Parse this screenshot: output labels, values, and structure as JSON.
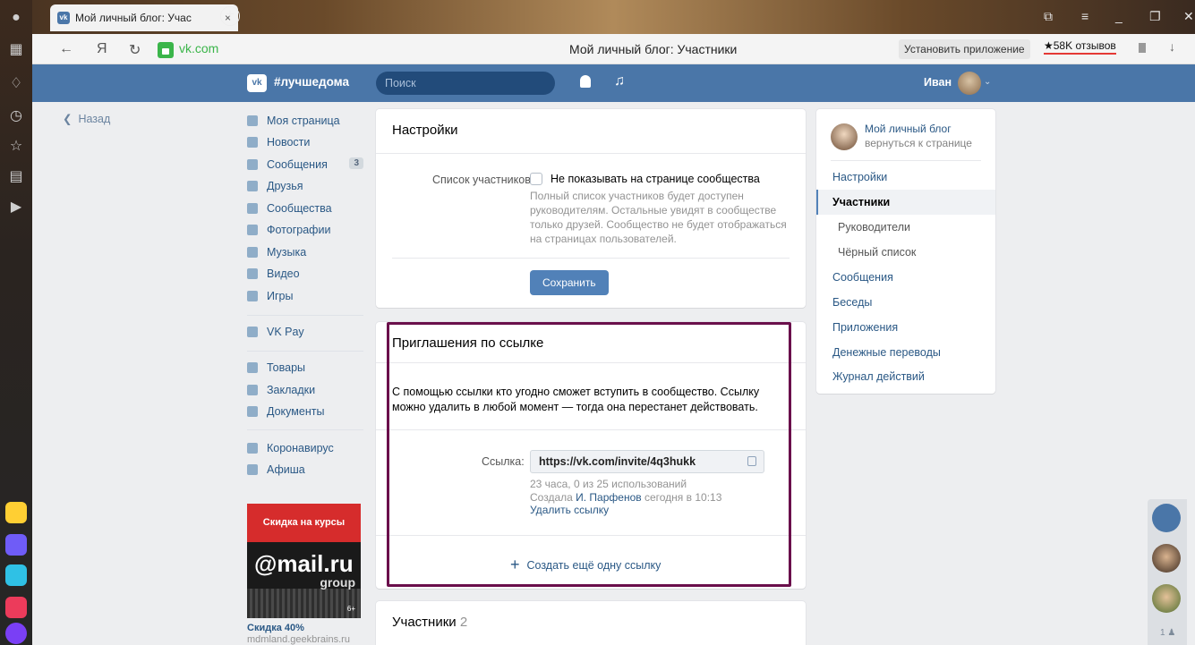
{
  "browser": {
    "tab_title": "Мой личный блог: Учас",
    "tab_close": "×",
    "new_tab": "+",
    "domain": "vk.com",
    "page_title": "Мой личный блог: Участники",
    "install_app": "Установить приложение",
    "reviews": "★58K отзывов",
    "nav_back": "←",
    "nav_yandex": "Я",
    "nav_reload": "↻",
    "download": "↓",
    "window_controls": [
      "⧉",
      "≡",
      "_",
      "❐",
      "✕"
    ]
  },
  "rail": {
    "icons": [
      "user-icon",
      "grid-icon",
      "bell-icon",
      "clock-icon",
      "star-icon",
      "notes-icon",
      "play-icon"
    ],
    "icon_glyphs": [
      "●",
      "▦",
      "♢",
      "◷",
      "☆",
      "▤",
      "▶"
    ],
    "apps": [
      "mail-icon",
      "messenger-icon",
      "send-icon",
      "video-icon",
      "alice-icon"
    ],
    "app_colors": [
      "#ffcf33",
      "#6f5cf7",
      "#2fc1e5",
      "#ec3b5b",
      "#7a3ff5"
    ]
  },
  "vk": {
    "logo": "vk",
    "brand": "#лучшедома",
    "search_placeholder": "Поиск",
    "user_name": "Иван",
    "chevron": "⌄",
    "back": "Назад"
  },
  "menu": {
    "items": [
      {
        "label": "Моя страница",
        "icon": "home-icon"
      },
      {
        "label": "Новости",
        "icon": "news-icon"
      },
      {
        "label": "Сообщения",
        "icon": "messages-icon",
        "badge": "3"
      },
      {
        "label": "Друзья",
        "icon": "friends-icon"
      },
      {
        "label": "Сообщества",
        "icon": "communities-icon"
      },
      {
        "label": "Фотографии",
        "icon": "photos-icon"
      },
      {
        "label": "Музыка",
        "icon": "music-icon"
      },
      {
        "label": "Видео",
        "icon": "video-icon"
      },
      {
        "label": "Игры",
        "icon": "games-icon"
      },
      {
        "label": "VK Pay",
        "icon": "vkpay-icon"
      },
      {
        "label": "Товары",
        "icon": "goods-icon"
      },
      {
        "label": "Закладки",
        "icon": "bookmarks-icon"
      },
      {
        "label": "Документы",
        "icon": "documents-icon"
      },
      {
        "label": "Коронавирус",
        "icon": "coronavirus-icon"
      },
      {
        "label": "Афиша",
        "icon": "afisha-icon"
      }
    ]
  },
  "ad": {
    "banner": "Скидка на курсы",
    "logo": "@mail.ru",
    "logo_sub": "group",
    "age": "6+",
    "title": "Скидка 40%",
    "url": "mdmland.geekbrains.ru"
  },
  "settings": {
    "title": "Настройки",
    "members_list_label": "Список участников:",
    "checkbox_label": "Не показывать на странице сообщества",
    "hint": "Полный список участников будет доступен руководителям. Остальные увидят в сообществе только друзей. Сообщество не будет отображаться на страницах пользователей.",
    "save": "Сохранить"
  },
  "invites": {
    "title": "Приглашения по ссылке",
    "description": "С помощью ссылки кто угодно сможет вступить в сообщество. Ссылку можно удалить в любой момент — тогда она перестанет действовать.",
    "link_label": "Ссылка:",
    "link_value": "https://vk.com/invite/4q3hukk",
    "usage": "23 часа, 0 из 25 использований",
    "created_prefix": "Создала",
    "created_by": "И. Парфенов",
    "created_suffix": "сегодня в 10:13",
    "delete": "Удалить ссылку",
    "create_plus": "+",
    "create": "Создать ещё одну ссылку"
  },
  "members": {
    "title": "Участники",
    "count": "2"
  },
  "right_nav": {
    "group_name": "Мой личный блог",
    "back_to_page": "вернуться к странице",
    "items": [
      {
        "label": "Настройки"
      },
      {
        "label": "Участники",
        "active": true
      },
      {
        "label": "Руководители"
      },
      {
        "label": "Чёрный список"
      },
      {
        "label": "Сообщения"
      },
      {
        "label": "Беседы"
      },
      {
        "label": "Приложения"
      },
      {
        "label": "Денежные переводы"
      },
      {
        "label": "Журнал действий"
      }
    ]
  },
  "floating": {
    "friends_count": "1"
  },
  "colors": {
    "vk_blue": "#4a76a8",
    "link": "#2a5885",
    "button": "#5181b8",
    "highlight_border": "#6a0f4b"
  }
}
